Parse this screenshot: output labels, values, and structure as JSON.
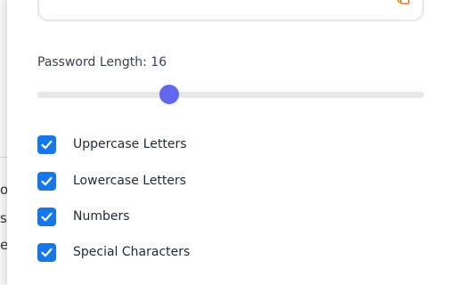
{
  "password_display": {
    "value": "•••••••••••••"
  },
  "length": {
    "label": "Password Length: 16",
    "value": 16,
    "slider_fraction": 0.34
  },
  "options": [
    {
      "label": "Uppercase Letters",
      "checked": true
    },
    {
      "label": "Lowercase Letters",
      "checked": true
    },
    {
      "label": "Numbers",
      "checked": true
    },
    {
      "label": "Special Characters",
      "checked": true
    }
  ],
  "background_fragments": [
    "o",
    "si",
    "e"
  ],
  "colors": {
    "accent": "#6366f1",
    "checkbox": "#1677e6",
    "track": "#e5e7eb",
    "copy_icon": "#f97316"
  },
  "icons": {
    "copy": "copy-icon",
    "check": "checkmark-icon"
  }
}
